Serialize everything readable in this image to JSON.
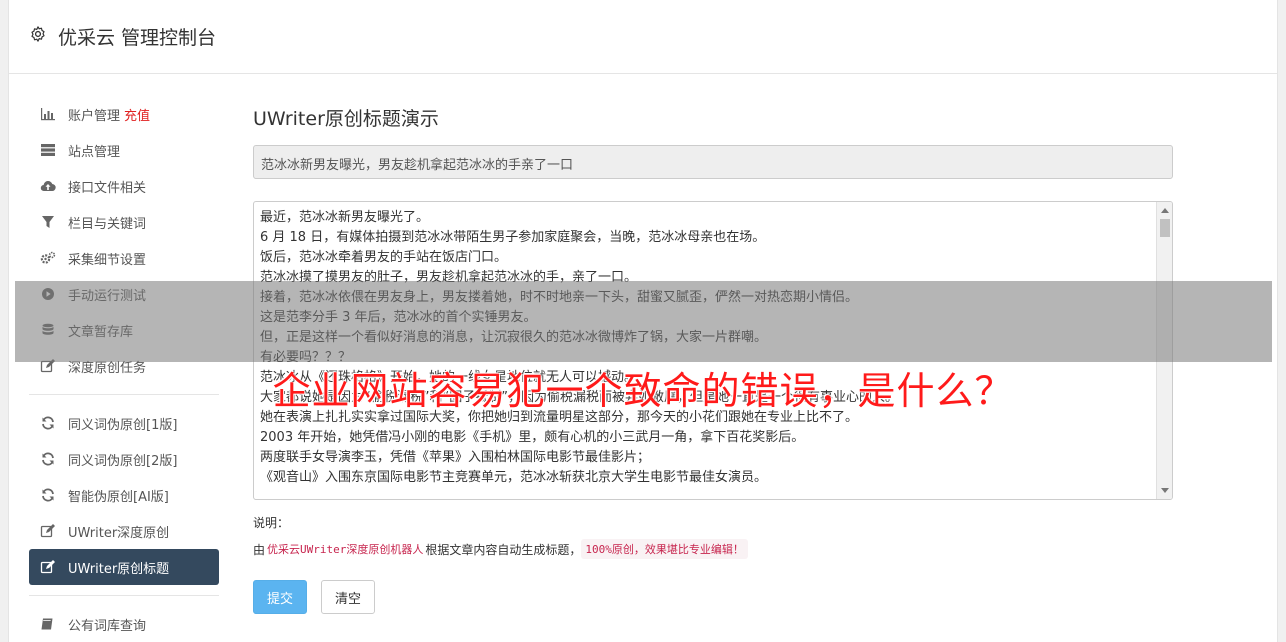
{
  "app": {
    "title": "优采云 管理控制台",
    "icon": "gear-icon"
  },
  "sidebar": {
    "group1": [
      {
        "label": "账户管理",
        "extra": "充值",
        "icon": "bar-chart-icon"
      },
      {
        "label": "站点管理",
        "icon": "server-icon"
      },
      {
        "label": "接口文件相关",
        "icon": "cloud-upload-icon"
      },
      {
        "label": "栏目与关键词",
        "icon": "filter-icon"
      },
      {
        "label": "采集细节设置",
        "icon": "cogs-icon"
      },
      {
        "label": "手动运行测试",
        "icon": "play-circle-icon"
      },
      {
        "label": "文章暂存库",
        "icon": "database-icon"
      },
      {
        "label": "深度原创任务",
        "icon": "edit-icon"
      }
    ],
    "group2": [
      {
        "label": "同义词伪原创[1版]",
        "icon": "refresh-icon"
      },
      {
        "label": "同义词伪原创[2版]",
        "icon": "refresh-icon"
      },
      {
        "label": "智能伪原创[AI版]",
        "icon": "refresh-icon"
      },
      {
        "label": "UWriter深度原创",
        "icon": "edit-icon"
      },
      {
        "label": "UWriter原创标题",
        "icon": "edit-icon",
        "active": true
      }
    ],
    "group3": [
      {
        "label": "公有词库查询",
        "icon": "book-icon"
      }
    ]
  },
  "main": {
    "heading": "UWriter原创标题演示",
    "title_value": "范冰冰新男友曝光，男友趁机拿起范冰冰的手亲了一口",
    "content_lines": [
      "最近，范冰冰新男友曝光了。",
      "6 月 18 日，有媒体拍摄到范冰冰带陌生男子参加家庭聚会，当晚，范冰冰母亲也在场。",
      "饭后，范冰冰牵着男友的手站在饭店门口。",
      "范冰冰摸了摸男友的肚子，男友趁机拿起范冰冰的手，亲了一口。",
      "接着，范冰冰依偎在男友身上，男友搂着她，时不时地亲一下头，甜蜜又腻歪，俨然一对热恋期小情侣。",
      "这是范李分手 3 年后，范冰冰的首个实锤男友。",
      "但，正是这样一个看似好消息的消息，让沉寂很久的范冰冰微博炸了锅，大家一片群嘲。",
      "有必要吗？？？",
      "范冰冰从《还珠格格》开始，她的一线女星地位就无人可以撼动。",
      "大家都说她是因为“偷税漏税”和“圈子抵制”，因为偷税漏税而被弃如敝屣，但是她一直是一个很有事业心的人。",
      "她在表演上扎扎实实拿过国际大奖，你把她归到流量明星这部分，那今天的小花们跟她在专业上比不了。",
      "2003 年开始，她凭借冯小刚的电影《手机》里，颇有心机的小三武月一角，拿下百花奖影后。",
      "两度联手女导演李玉，凭借《苹果》入围柏林国际电影节最佳影片；",
      "《观音山》入围东京国际电影节主竞赛单元，范冰冰斩获北京大学生电影节最佳女演员。"
    ],
    "desc_label": "说明：",
    "desc_prefix": "由",
    "desc_code1": "优采云UWriter深度原创机器人",
    "desc_middle": "根据文章内容自动生成标题，",
    "desc_code2": "100%原创，效果堪比专业编辑！",
    "submit_label": "提交",
    "clear_label": "清空"
  },
  "overlay": {
    "text": "企业网站容易犯一个致命的错误，是什么？"
  }
}
